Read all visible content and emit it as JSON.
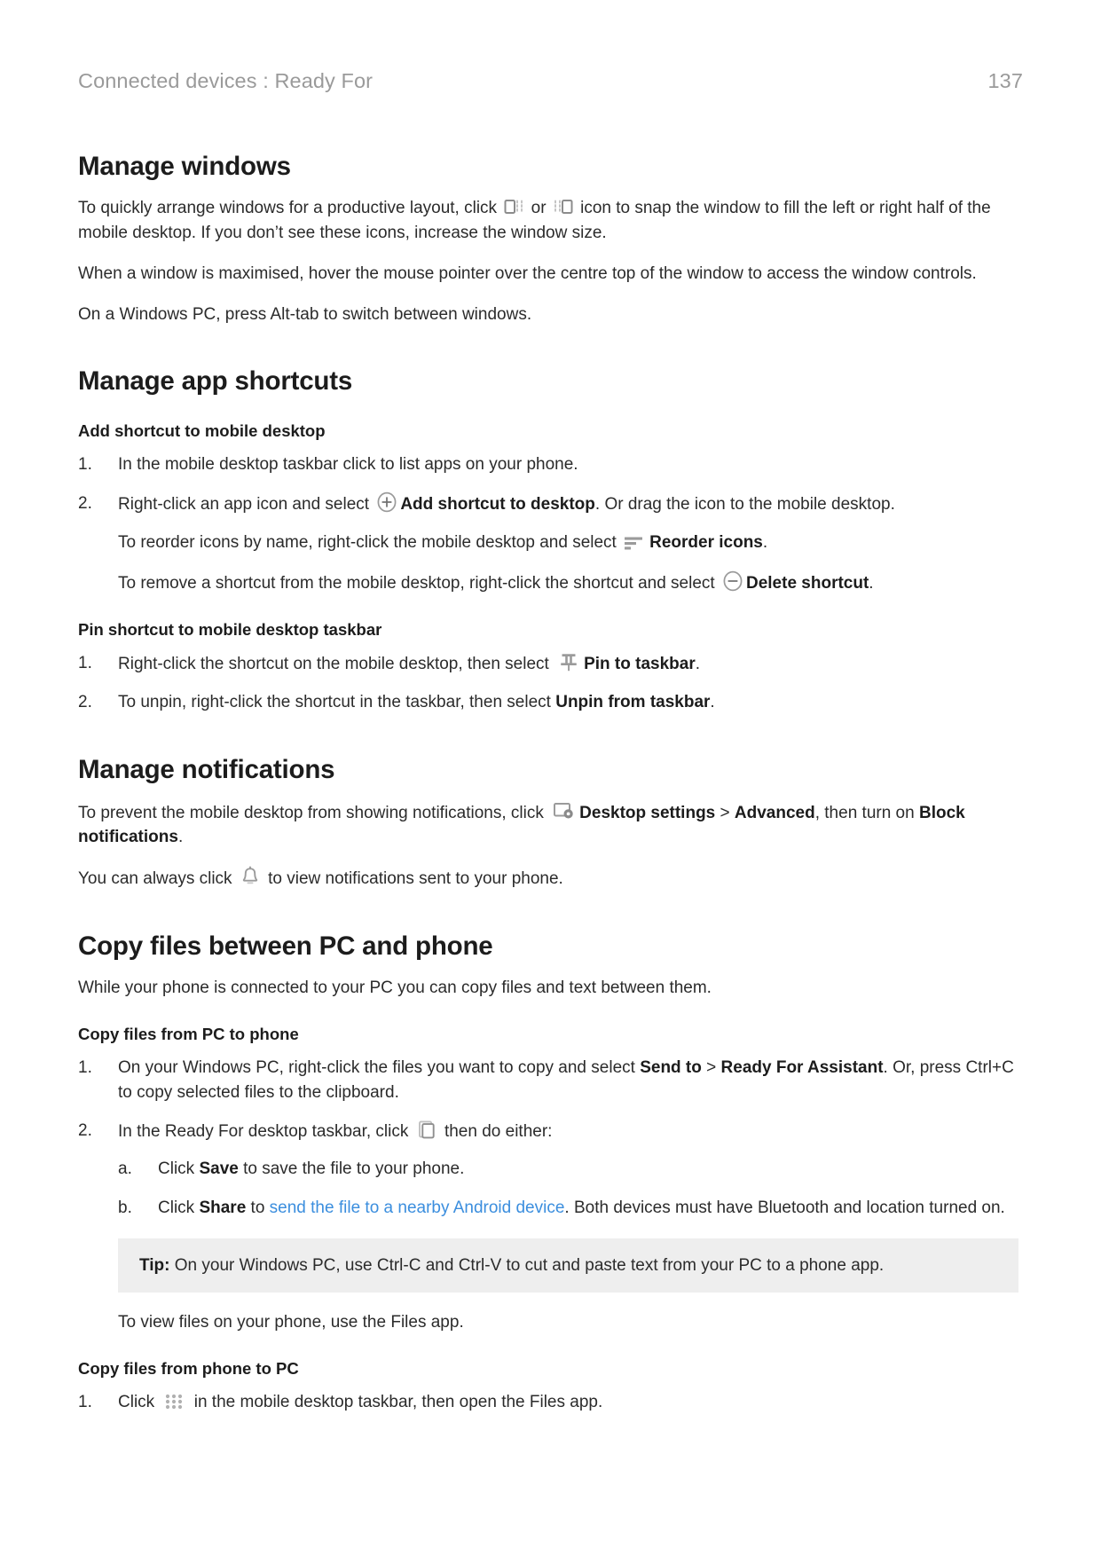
{
  "header": {
    "breadcrumb": "Connected devices : Ready For",
    "page_number": "137"
  },
  "colors": {
    "text": "#2b2b2b",
    "heading": "#1c1c1c",
    "header_gray": "#9a9a9a",
    "link_blue": "#3b8ede",
    "icon_gray": "#8c8c8c",
    "tip_background": "#eeeeee"
  },
  "sections": {
    "manage_windows": {
      "title": "Manage windows",
      "p1_a": "To quickly arrange windows for a productive layout, click",
      "p1_or": "or",
      "p1_b": "icon to snap the window to fill the left or right half of the mobile desktop. If you don’t see these icons, increase the window size.",
      "p2": "When a window is maximised, hover the mouse pointer over the centre top of the window to access the window controls.",
      "p3": "On a Windows PC, press Alt-tab to switch between windows."
    },
    "manage_app_shortcuts": {
      "title": "Manage app shortcuts",
      "sub_add": "Add shortcut to mobile desktop",
      "item1_mark": "1.",
      "item1": "In the mobile desktop taskbar click to list apps on your phone.",
      "item2_mark": "2.",
      "item2_a": "Right-click an app icon and select",
      "item2_bold": "Add shortcut to desktop",
      "item2_b": ". Or drag the icon to the mobile desktop.",
      "reorder_a": "To reorder icons by name, right-click the mobile desktop and select",
      "reorder_bold": "Reorder icons",
      "reorder_b": ".",
      "remove_a": "To remove a shortcut from the mobile desktop, right-click the shortcut and select",
      "remove_bold": "Delete shortcut",
      "remove_b": ".",
      "sub_pin": "Pin shortcut to mobile desktop taskbar",
      "pin1_mark": "1.",
      "pin1_a": "Right-click the shortcut on the mobile desktop, then select",
      "pin1_bold": "Pin to taskbar",
      "pin1_b": ".",
      "pin2_mark": "2.",
      "pin2_a": "To unpin, right-click the shortcut in the taskbar, then select",
      "pin2_bold": "Unpin from taskbar",
      "pin2_b": "."
    },
    "manage_notifications": {
      "title": "Manage notifications",
      "p1_a": "To prevent the mobile desktop from showing notifications, click",
      "p1_bold1": "Desktop settings",
      "p1_gt": " > ",
      "p1_bold2": "Advanced",
      "p1_b": ", then turn on ",
      "p1_bold3": "Block notifications",
      "p1_c": ".",
      "p2_a": "You can always click",
      "p2_b": "to view notifications sent to your phone."
    },
    "copy_files": {
      "title": "Copy files between PC and phone",
      "intro": "While your phone is connected to your PC you can copy files and text between them.",
      "sub_pc_to_phone": "Copy files from PC to phone",
      "item1_mark": "1.",
      "item1_a": "On your Windows PC, right-click the files you want to copy and select ",
      "item1_bold1": "Send to",
      "item1_gt": " > ",
      "item1_bold2": "Ready For Assistant",
      "item1_b": ". Or, press Ctrl+C to copy selected files to the clipboard.",
      "item2_mark": "2.",
      "item2_a": "In the Ready For desktop taskbar, click",
      "item2_b": "then do either:",
      "a_mark": "a.",
      "a_text_pre": "Click ",
      "a_bold": "Save",
      "a_text_post": " to save the file to your phone.",
      "b_mark": "b.",
      "b_text_pre": "Click ",
      "b_bold": "Share",
      "b_text_mid": " to ",
      "b_link": "send the file to a nearby Android device",
      "b_text_post": ". Both devices must have Bluetooth and location turned on.",
      "tip_label": "Tip:",
      "tip_text": " On your Windows PC, use Ctrl-C and Ctrl-V to cut and paste text from your PC to a phone app.",
      "view_files": "To view files on your phone, use the Files app.",
      "sub_phone_to_pc": "Copy files from phone to PC",
      "last1_mark": "1.",
      "last1_a": "Click",
      "last1_b": "in the mobile desktop taskbar, then open the Files app."
    }
  },
  "icons": {
    "snap_left": "snap-window-left-icon",
    "snap_right": "snap-window-right-icon",
    "add_circle": "plus-circle-icon",
    "reorder": "sort-lines-icon",
    "delete_circle": "minus-circle-icon",
    "pin": "pushpin-icon",
    "desktop_settings": "desktop-settings-gear-icon",
    "bell": "bell-icon",
    "phone_clipboard": "phone-clipboard-icon",
    "app_drawer": "app-drawer-dots-icon"
  }
}
